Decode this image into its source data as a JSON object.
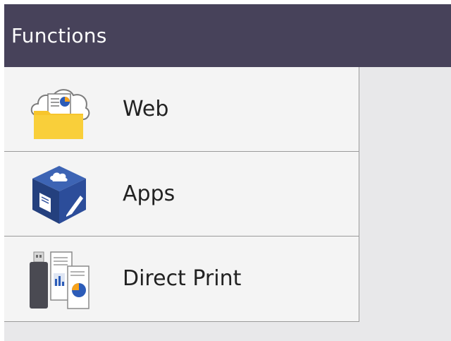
{
  "header": {
    "title": "Functions"
  },
  "menu": {
    "items": [
      {
        "label": "Web",
        "icon": "web-cloud-folder-icon"
      },
      {
        "label": "Apps",
        "icon": "apps-cube-icon"
      },
      {
        "label": "Direct Print",
        "icon": "usb-documents-icon"
      }
    ]
  },
  "colors": {
    "header_bg": "#47425a",
    "list_bg": "#f4f4f4",
    "screen_bg": "#e8e8ea",
    "folder_yellow": "#f7c52c",
    "cube_blue": "#2c4d9a"
  }
}
